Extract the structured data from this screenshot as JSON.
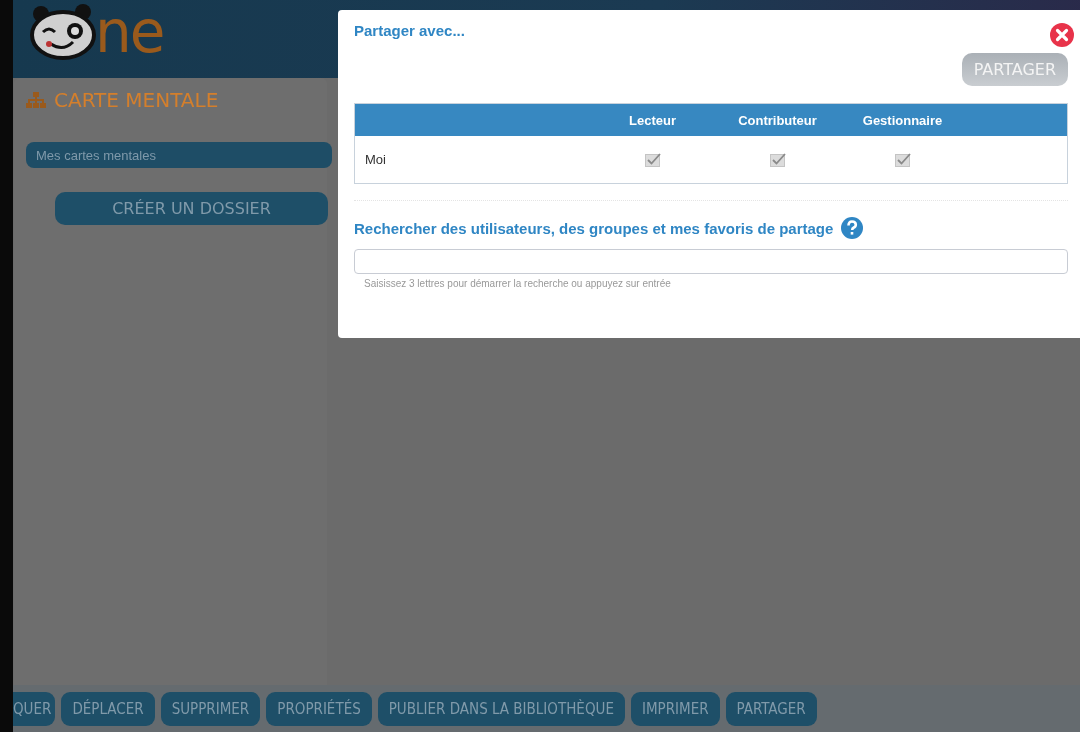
{
  "logo": {
    "text": "ne"
  },
  "sidebar": {
    "title": "CARTE MENTALE",
    "items": [
      {
        "label": "Mes cartes mentales",
        "selected": true
      }
    ],
    "create_button": "CRÉER UN DOSSIER"
  },
  "toolbar": {
    "buttons": [
      "QUER",
      "DÉPLACER",
      "SUPPRIMER",
      "PROPRIÉTÉS",
      "PUBLIER DANS LA BIBLIOTHÈQUE",
      "IMPRIMER",
      "PARTAGER"
    ]
  },
  "dialog": {
    "title": "Partager avec...",
    "share_button": {
      "label": "PARTAGER",
      "disabled": true
    },
    "table": {
      "columns": [
        "Lecteur",
        "Contributeur",
        "Gestionnaire"
      ],
      "rows": [
        {
          "name": "Moi",
          "rights": [
            {
              "checked": true,
              "disabled": true
            },
            {
              "checked": true,
              "disabled": true
            },
            {
              "checked": true,
              "disabled": true
            }
          ]
        }
      ]
    },
    "search": {
      "heading": "Rechercher des utilisateurs, des groupes et mes favoris de partage",
      "hint": "Saisissez 3 lettres pour démarrer la recherche ou appuyez sur entrée"
    }
  }
}
